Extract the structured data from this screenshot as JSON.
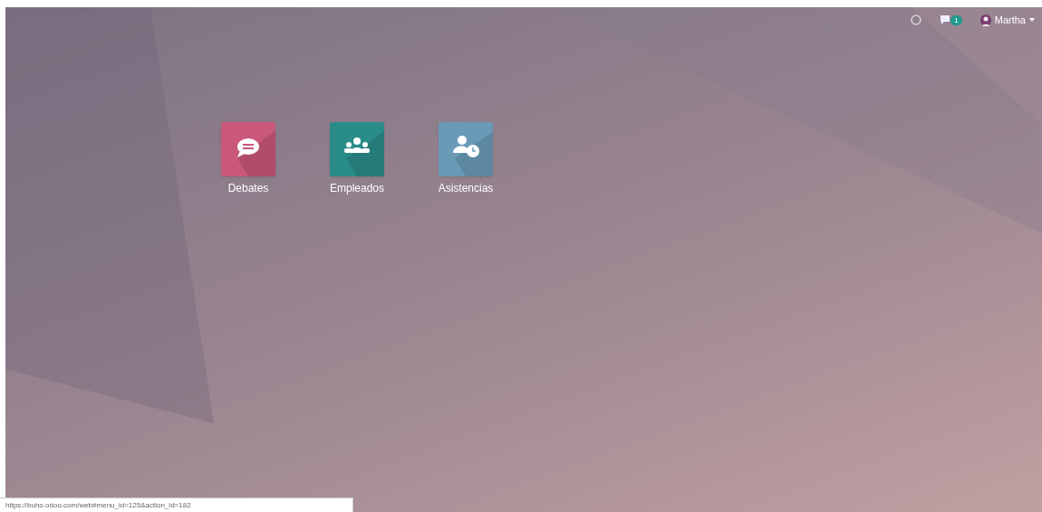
{
  "navbar": {
    "chat_badge": "1",
    "user": "Martha"
  },
  "apps": [
    {
      "label": "Debates",
      "kind": "chat",
      "color": "#c9587a"
    },
    {
      "label": "Empleados",
      "kind": "people",
      "color": "#2a8c88"
    },
    {
      "label": "Asistencias",
      "kind": "attendance",
      "color": "#6a9bb6"
    }
  ],
  "status_url": "https://buho.odoo.com/web#menu_id=125&action_id=182"
}
